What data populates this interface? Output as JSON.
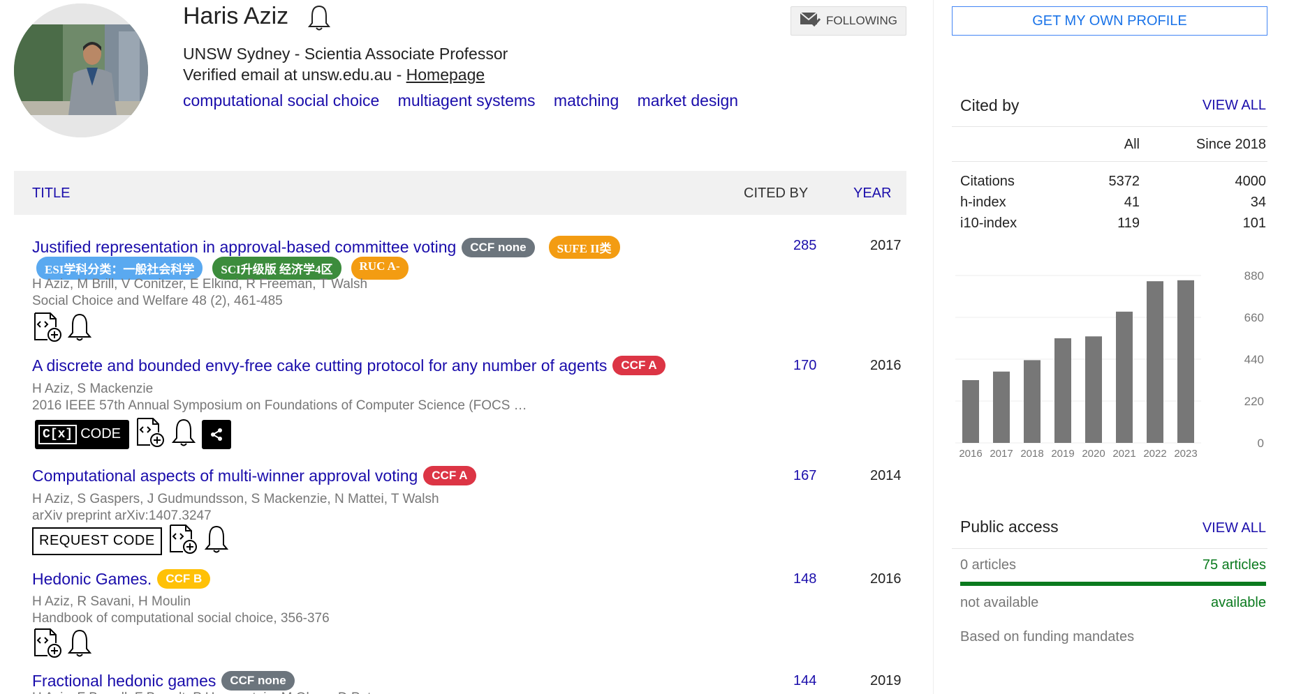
{
  "profile": {
    "name": "Haris Aziz",
    "affiliation": "UNSW Sydney - Scientia Associate Professor",
    "email_text": "Verified email at unsw.edu.au - ",
    "homepage_label": "Homepage",
    "interests": [
      "computational social choice",
      "multiagent systems",
      "matching",
      "market design"
    ],
    "follow_label": "FOLLOWING"
  },
  "table": {
    "col_title": "TITLE",
    "col_cited": "CITED BY",
    "col_year": "YEAR"
  },
  "papers": [
    {
      "title": "Justified representation in approval-based committee voting",
      "badges": [
        "CCF none",
        "SUFE II类",
        "ESI学科分类：一般社会科学",
        "SCI升级版 经济学4区",
        "RUC A-"
      ],
      "authors": "H Aziz, M Brill, V Conitzer, E Elkind, R Freeman, T Walsh",
      "venue": "Social Choice and Welfare 48 (2), 461-485",
      "cited": "285",
      "year": "2017"
    },
    {
      "title": "A discrete and bounded envy-free cake cutting protocol for any number of agents",
      "badges": [
        "CCF A"
      ],
      "authors": "H Aziz, S Mackenzie",
      "venue": "2016 IEEE 57th Annual Symposium on Foundations of Computer Science (FOCS …",
      "cited": "170",
      "year": "2016",
      "code_label": "CODE",
      "code_icon": "C[x]"
    },
    {
      "title": "Computational aspects of multi-winner approval voting",
      "badges": [
        "CCF A"
      ],
      "authors": "H Aziz, S Gaspers, J Gudmundsson, S Mackenzie, N Mattei, T Walsh",
      "venue": "arXiv preprint arXiv:1407.3247",
      "cited": "167",
      "year": "2014",
      "request_label": "REQUEST CODE"
    },
    {
      "title": "Hedonic Games.",
      "badges": [
        "CCF B"
      ],
      "authors": "H Aziz, R Savani, H Moulin",
      "venue": "Handbook of computational social choice, 356-376",
      "cited": "148",
      "year": "2016"
    },
    {
      "title": "Fractional hedonic games",
      "badges": [
        "CCF none"
      ],
      "authors": "H Aziz, F Brandl, F Brandt, P Harrenstein, M Olsen, D Peters",
      "cited": "144",
      "year": "2019"
    }
  ],
  "sidebar": {
    "get_profile": "GET MY OWN PROFILE",
    "cited_by": {
      "heading": "Cited by",
      "view_all": "VIEW ALL",
      "col_all": "All",
      "col_since": "Since 2018",
      "rows": [
        {
          "label": "Citations",
          "all": "5372",
          "since": "4000"
        },
        {
          "label": "h-index",
          "all": "41",
          "since": "34"
        },
        {
          "label": "i10-index",
          "all": "119",
          "since": "101"
        }
      ]
    },
    "public_access": {
      "heading": "Public access",
      "view_all": "VIEW ALL",
      "left_count": "0 articles",
      "right_count": "75 articles",
      "left_status": "not available",
      "right_status": "available",
      "note": "Based on funding mandates",
      "available_fraction": 1.0
    }
  },
  "chart_data": {
    "type": "bar",
    "categories": [
      "2016",
      "2017",
      "2018",
      "2019",
      "2020",
      "2021",
      "2022",
      "2023"
    ],
    "values": [
      330,
      375,
      435,
      550,
      560,
      690,
      850,
      855
    ],
    "ylim": [
      0,
      880
    ],
    "yticks": [
      "880",
      "660",
      "440",
      "220",
      "0"
    ],
    "grid": true,
    "color": "#777777"
  }
}
